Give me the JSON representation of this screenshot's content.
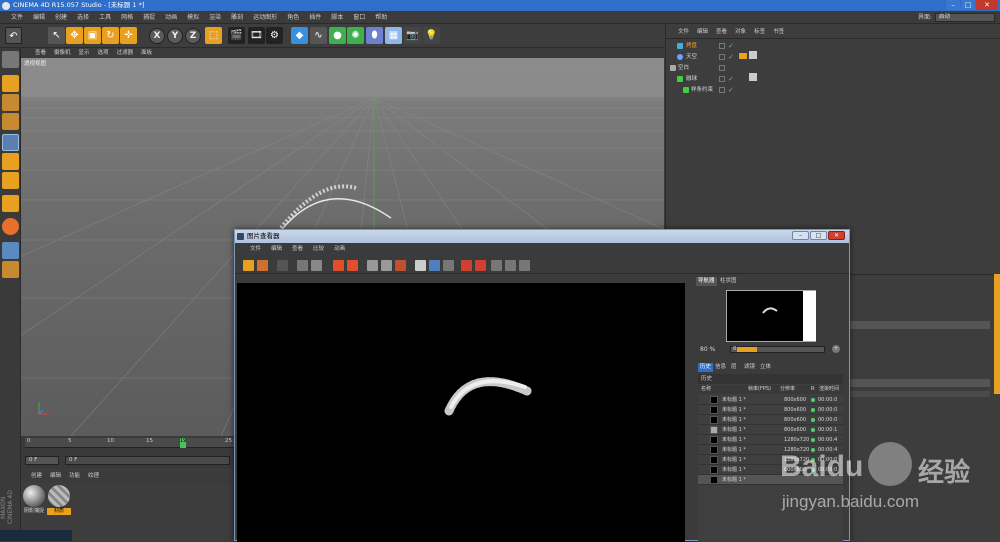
{
  "window": {
    "title": "CINEMA 4D R15.057 Studio - [未标题 1 *]"
  },
  "menubar": {
    "items": [
      "文件",
      "编辑",
      "创建",
      "选择",
      "工具",
      "网格",
      "捕捉",
      "动画",
      "模拟",
      "渲染",
      "雕刻",
      "运动图形",
      "角色",
      "插件",
      "脚本",
      "窗口",
      "帮助"
    ],
    "layout_label": "界面:",
    "layout_value": "启动"
  },
  "viewport": {
    "menu": [
      "查看",
      "摄像机",
      "显示",
      "选项",
      "过滤器",
      "面板"
    ],
    "label": "透视视图"
  },
  "timeline": {
    "ticks": [
      "0",
      "5",
      "10",
      "15",
      "19",
      "20",
      "25"
    ],
    "current_frame": "19",
    "frame_start": "0 F",
    "frame_field": "0 F"
  },
  "materials": {
    "menu": [
      "创建",
      "编辑",
      "功能",
      "纹理"
    ],
    "items": [
      {
        "label": "阴影捕捉",
        "color": "#8a8a8a"
      },
      {
        "label": "材质",
        "color": "#e0a020"
      }
    ],
    "brand": "MAXON CINEMA 4D"
  },
  "objects": {
    "menu": [
      "文件",
      "编辑",
      "查看",
      "对象",
      "标签",
      "书签"
    ],
    "rows": [
      {
        "name": "烤盘",
        "color": "#ff9a1a",
        "icon_color": "#3fb0e0"
      },
      {
        "name": "天空",
        "color": "#d6d6d6",
        "icon_color": "#6fa0ff"
      },
      {
        "name": "空白",
        "color": "#d6d6d6",
        "icon_color": "#aaaaaa"
      },
      {
        "name": "融球",
        "color": "#d6d6d6",
        "icon_color": "#3fd03f"
      },
      {
        "name": "样条约束",
        "color": "#d6d6d6",
        "icon_color": "#3fd03f"
      }
    ]
  },
  "picture_viewer": {
    "title": "图片查看器",
    "menu": [
      "文件",
      "编辑",
      "查看",
      "比较",
      "动画"
    ],
    "side_tabs": [
      "导航器",
      "柱状图"
    ],
    "zoom": "80 %",
    "zoom_value": "8",
    "history_tabs": [
      "历史",
      "信息",
      "层",
      "滤镜",
      "立体"
    ],
    "history_heading": "历史",
    "columns": [
      "名称",
      "帧率(FPS)",
      "分辨率",
      "R",
      "渲染时间"
    ],
    "rows": [
      {
        "name": "未标题 1 *",
        "res": "800x600",
        "time": "00:00:0"
      },
      {
        "name": "未标题 1 *",
        "res": "800x600",
        "time": "00:00:0"
      },
      {
        "name": "未标题 1 *",
        "res": "800x600",
        "time": "00:00:0"
      },
      {
        "name": "未标题 1 *",
        "res": "800x600",
        "time": "00:00:1"
      },
      {
        "name": "未标题 1 *",
        "res": "1280x720",
        "time": "00:00:4"
      },
      {
        "name": "未标题 1 *",
        "res": "1280x720",
        "time": "00:00:4"
      },
      {
        "name": "未标题 1 *",
        "res": "1280x720",
        "time": "00:00:0"
      },
      {
        "name": "未标题 1 *",
        "res": "800x600",
        "time": "00:00:0"
      },
      {
        "name": "未标题 1 *",
        "res": "",
        "time": ""
      }
    ]
  },
  "watermark": {
    "brand": "Baidu",
    "suffix": "经验",
    "url": "jingyan.baidu.com"
  },
  "colors": {
    "accent_orange": "#e8a020",
    "active_blue": "#2f6fc9",
    "status_green": "#4fd070"
  }
}
